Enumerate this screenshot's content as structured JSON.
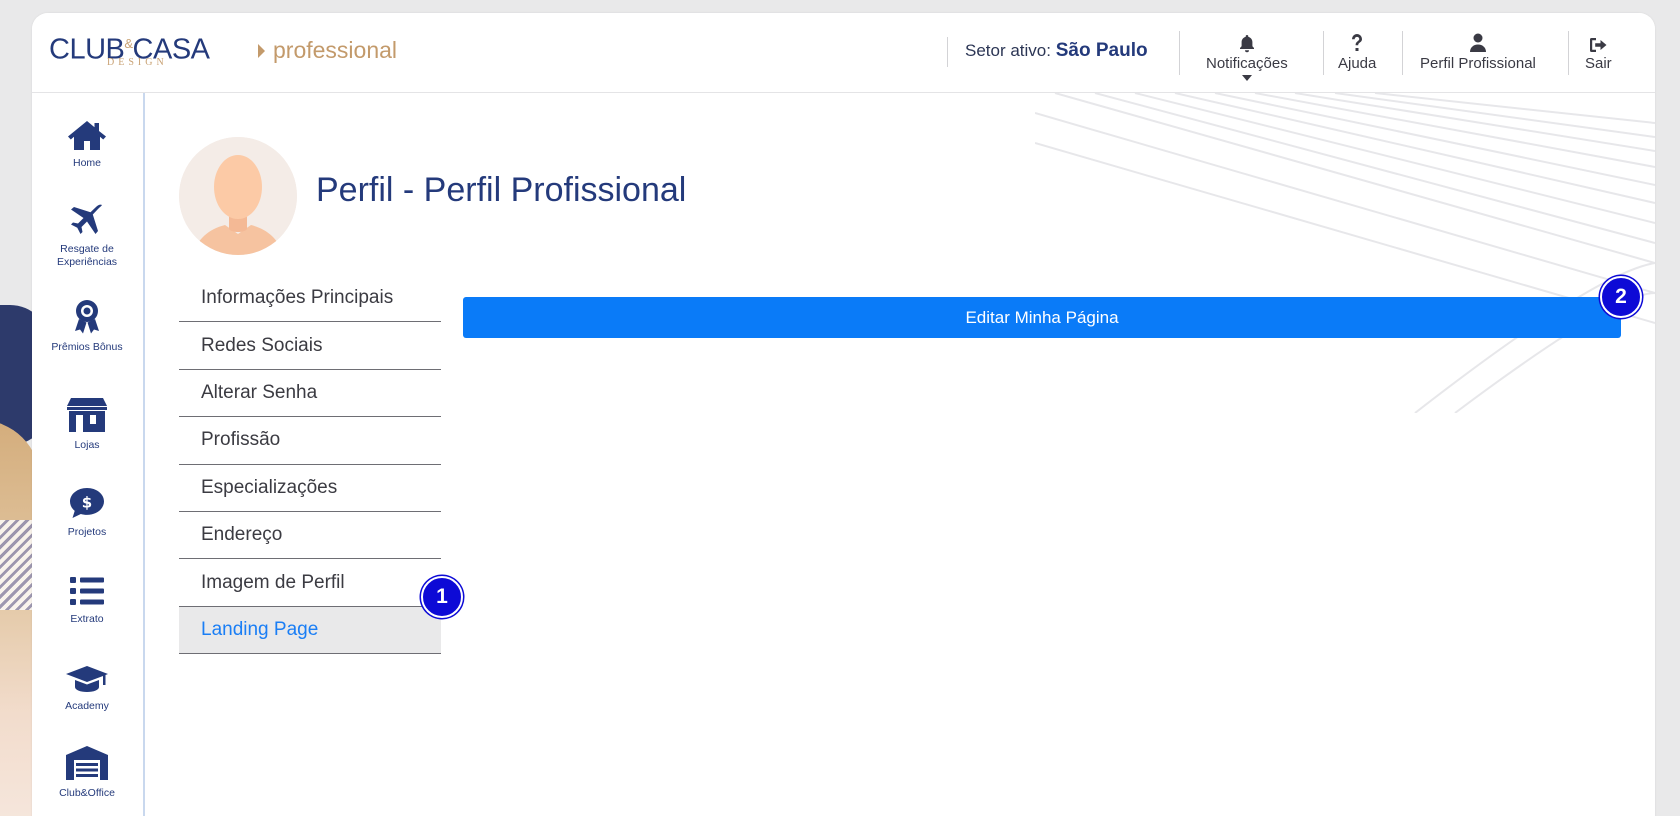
{
  "brand": {
    "logo_main": "CLUB",
    "logo_amp": "&",
    "logo_main2": "CASA",
    "logo_sub": "DESIGN",
    "product": "professional"
  },
  "header": {
    "setor_label": "Setor ativo:",
    "setor_value": "São Paulo",
    "notifications_label": "Notificações",
    "help_label": "Ajuda",
    "profile_label": "Perfil Profissional",
    "logout_label": "Sair"
  },
  "sidebar": {
    "items": [
      {
        "label": "Home",
        "icon": "home-icon"
      },
      {
        "label": "Resgate de Experiências",
        "icon": "airplane-icon"
      },
      {
        "label": "Prêmios Bônus",
        "icon": "award-ribbon-icon"
      },
      {
        "label": "Lojas",
        "icon": "store-icon"
      },
      {
        "label": "Projetos",
        "icon": "dollar-chat-icon"
      },
      {
        "label": "Extrato",
        "icon": "list-icon"
      },
      {
        "label": "Academy",
        "icon": "graduation-cap-icon"
      },
      {
        "label": "Club&Office",
        "icon": "garage-icon"
      }
    ]
  },
  "main": {
    "title": "Perfil - Perfil Profissional",
    "menu": [
      "Informações Principais",
      "Redes Sociais",
      "Alterar Senha",
      "Profissão",
      "Especializações",
      "Endereço",
      "Imagem de Perfil",
      "Landing Page"
    ],
    "active_menu": "Landing Page",
    "edit_button": "Editar Minha Página"
  },
  "annotations": {
    "badge_1": "1",
    "badge_2": "2"
  },
  "colors": {
    "navy": "#243a7b",
    "gold": "#c39a6b",
    "primary_button": "#0a7bf8",
    "active_link": "#1a7ef5",
    "badge": "#0d0ad6"
  }
}
